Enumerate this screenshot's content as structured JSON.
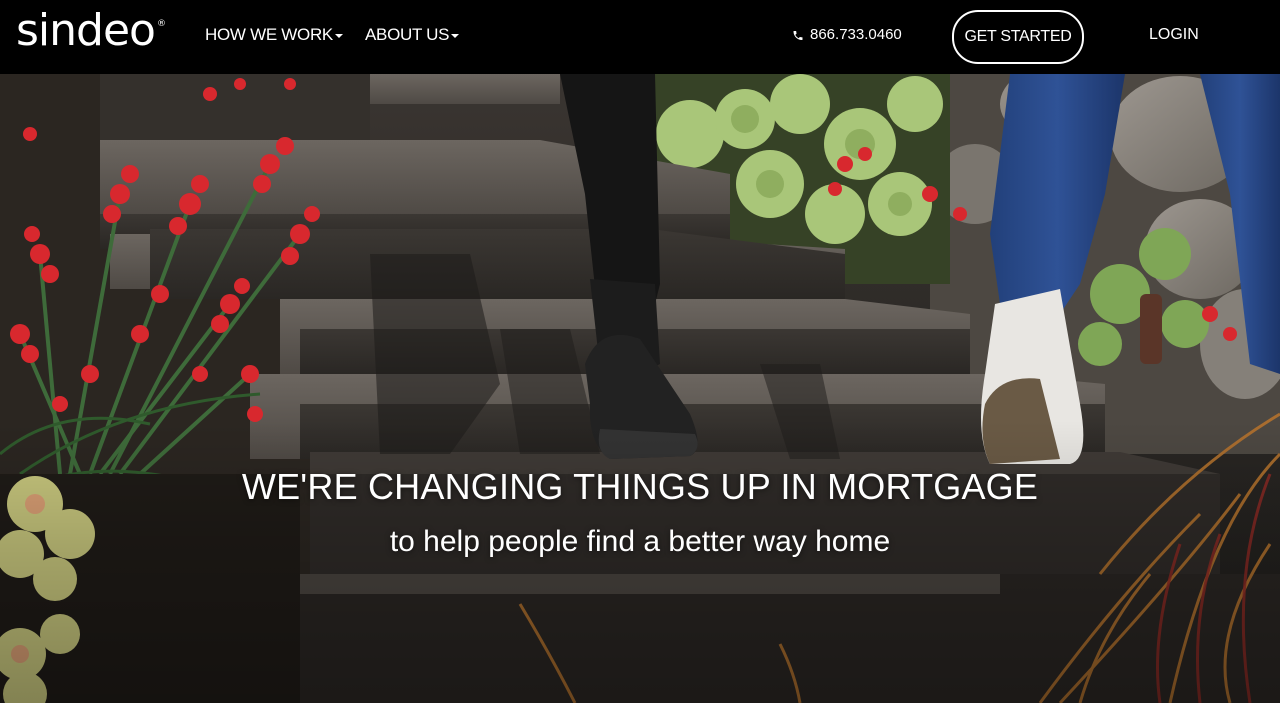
{
  "brand": {
    "logo_text": "sindeo",
    "registered_mark": "®"
  },
  "nav": {
    "how_we_work": "HOW WE WORK",
    "about_us": "ABOUT US",
    "phone_icon": "phone-icon",
    "phone": "866.733.0460",
    "get_started": "GET STARTED",
    "login": "LOGIN"
  },
  "hero": {
    "headline": "WE'RE CHANGING THINGS UP IN MORTGAGE",
    "subheadline": "to help people find a better way home"
  },
  "colors": {
    "nav_background": "#000000",
    "text": "#ffffff",
    "flower_red": "#d8282e",
    "succulent_green": "#9cbf6b",
    "jeans_blue": "#2a4a86"
  }
}
